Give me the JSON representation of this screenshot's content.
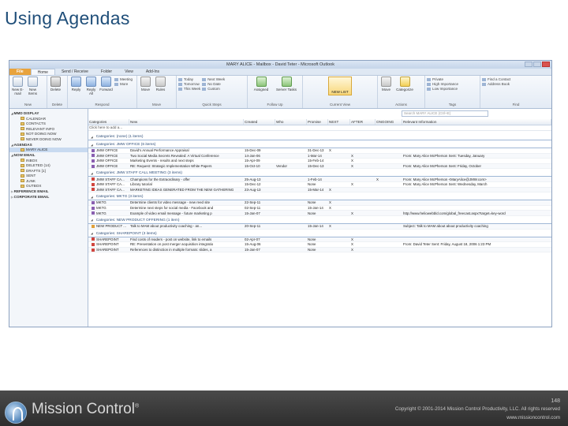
{
  "slide": {
    "title": "Using Agendas"
  },
  "window": {
    "title": "MARY ALICE - Mailbox - David Teter - Microsoft Outlook"
  },
  "ribbon": {
    "tabs": [
      "File",
      "Home",
      "Send / Receive",
      "Folder",
      "View",
      "Add-Ins"
    ],
    "groups": [
      {
        "label": "New",
        "buttons": [
          "New E-mail",
          "New Items"
        ]
      },
      {
        "label": "Delete",
        "buttons": [
          "Delete"
        ]
      },
      {
        "label": "Respond",
        "buttons": [
          "Reply",
          "Reply All",
          "Forward",
          "Meeting",
          "More"
        ]
      },
      {
        "label": "Move",
        "buttons": [
          "Move",
          "Rules"
        ]
      },
      {
        "label": "Quick Steps",
        "buttons": [
          "Today",
          "Tomorrow",
          "This Week",
          "Next Week",
          "No Date",
          "Custom"
        ]
      },
      {
        "label": "Follow Up",
        "buttons": [
          "Assigned",
          "Server Tasks"
        ]
      },
      {
        "label": "Current View",
        "buttons": [
          "NEW LIST"
        ]
      },
      {
        "label": "Actions",
        "buttons": [
          "Move",
          "Categorize"
        ]
      },
      {
        "label": "Tags",
        "buttons": [
          "Private",
          "High Importance",
          "Low Importance"
        ]
      },
      {
        "label": "Find",
        "buttons": [
          "Find a Contact",
          "Address Book"
        ]
      }
    ]
  },
  "nav": {
    "sections": [
      {
        "label": "MMD DISPLAY",
        "open": true,
        "items": [
          "CALENDAR",
          "CONTACTS",
          "RELEVANT INFO",
          "NOT DOING NOW",
          "NEVER DOING NOW"
        ]
      },
      {
        "label": "AGENDAS",
        "open": true,
        "items": [
          "MARY ALICE"
        ]
      },
      {
        "label": "NOW EMAIL",
        "open": true,
        "items": [
          "INBOX",
          "DELETED (14)",
          "DRAFTS [1]",
          "SENT",
          "JUNK",
          "OUTBOX"
        ]
      },
      {
        "label": "REFERENCE EMAIL",
        "open": false,
        "items": []
      },
      {
        "label": "CORPORATE EMAIL",
        "open": false,
        "items": []
      }
    ]
  },
  "search": {
    "placeholder": "Search MARY ALICE (Ctrl+E)"
  },
  "columns": [
    "Categories",
    "New",
    "Created",
    "Who",
    "Promise",
    "NEXT",
    "AFTER",
    "ONGOING",
    "Relevant Information"
  ],
  "add_row": {
    "category": "Click here to add a...",
    "text": ""
  },
  "groups": [
    {
      "header": "Categories: (none) (1 items)",
      "rows": []
    },
    {
      "header": "Categories: JMW OFFICE (6 items)",
      "color": "#8a5fb0",
      "rows": [
        {
          "cat": "JMW OFFICE",
          "new": "David's Annual Performance Appraisal",
          "created": "15-Dec-09",
          "who": "",
          "promise": "31-Dec-13",
          "next": "X",
          "after": "",
          "ongoing": "",
          "rel": ""
        },
        {
          "cat": "JMW OFFICE",
          "new": "Two Social Media Secrets Revealed: A Virtual Conference",
          "created": "14-Jan-06",
          "who": "",
          "promise": "1-Mar-14",
          "next": "",
          "after": "X",
          "ongoing": "",
          "rel": "From: Mary Alice McPherson  Sent: Tuesday, January"
        },
        {
          "cat": "JMW OFFICE",
          "new": "Marketing Events - results and next steps",
          "created": "15-Apr-09",
          "who": "",
          "promise": "15-Feb-14",
          "next": "",
          "after": "X",
          "ongoing": "",
          "rel": ""
        },
        {
          "cat": "JMW OFFICE",
          "new": "RE: Request: Strategic Implementation White Papers",
          "created": "15-Oct-10",
          "who": "Vendor",
          "promise": "15-Dec-13",
          "next": "",
          "after": "X",
          "ongoing": "",
          "rel": "From: Mary Alice McPherson  Sent: Friday, October"
        }
      ]
    },
    {
      "header": "Categories: JMW STAFF CALL MEETING (3 items)",
      "color": "#d0463f",
      "rows": [
        {
          "cat": "JMW STAFF CA...",
          "new": "Champions for the Extraordinary - offer",
          "created": "25-Aug-13",
          "who": "",
          "promise": "1-Feb-14",
          "next": "",
          "after": "",
          "ongoing": "X",
          "rel": "From: Mary Alice McPherson <MaryAlice@JMW.com>"
        },
        {
          "cat": "JMW STAFF CA...",
          "new": "Library tutorial",
          "created": "15-Dec-12",
          "who": "",
          "promise": "None",
          "next": "",
          "after": "X",
          "ongoing": "",
          "rel": "From: Mary Alice McPherson  Sent: Wednesday, March"
        },
        {
          "cat": "JMW STAFF CA...",
          "new": "MARKETING IDEAS GENERATED FROM THE NEW GATHERING",
          "created": "23-Aug-13",
          "who": "",
          "promise": "15-Mar-14",
          "next": "X",
          "after": "",
          "ongoing": "",
          "rel": ""
        }
      ]
    },
    {
      "header": "Categories: MKTG (3 items)",
      "color": "#8a5fb0",
      "rows": [
        {
          "cat": "MKTG",
          "new": "Determine clients for video message - new reed site",
          "created": "22-Sep-11",
          "who": "",
          "promise": "None",
          "next": "X",
          "after": "",
          "ongoing": "",
          "rel": ""
        },
        {
          "cat": "MKTG",
          "new": "Determine next steps for social media - Facebook and",
          "created": "02-Sep-11",
          "who": "",
          "promise": "15-Jan-14",
          "next": "X",
          "after": "",
          "ongoing": "",
          "rel": ""
        },
        {
          "cat": "MKTG",
          "new": "Example of video email message - future marketing p",
          "created": "15-Jan-07",
          "who": "",
          "promise": "None",
          "next": "",
          "after": "X",
          "ongoing": "",
          "rel": "http://www.heliowebbld.com/global_freecast.aspx?target=key-word"
        }
      ]
    },
    {
      "header": "Categories: NEW PRODUCT OFFERING (1 item)",
      "color": "#e0a03a",
      "rows": [
        {
          "cat": "NEW PRODUCT ...",
          "new": "Talk to MAM about productivity coaching - an...",
          "created": "20-Sep-11",
          "who": "",
          "promise": "15-Jan-14",
          "next": "X",
          "after": "",
          "ongoing": "",
          "rel": "Subject:   Talk to MAM about about productivity coaching"
        }
      ]
    },
    {
      "header": "Categories: SHAREPOINT (3 items)",
      "color": "#d0463f",
      "rows": [
        {
          "cat": "SHAREPOINT",
          "new": "Find costs of readers - post on website, link to emails",
          "created": "02-Apr-07",
          "who": "",
          "promise": "None",
          "next": "",
          "after": "X",
          "ongoing": "",
          "rel": ""
        },
        {
          "cat": "SHAREPOINT",
          "new": "RE: Presentation on post merger acquisition integratio",
          "created": "15-Aug-06",
          "who": "",
          "promise": "None",
          "next": "",
          "after": "X",
          "ongoing": "",
          "rel": "From: David Teter  Sent: Friday, August 18, 2006 1:23 PM"
        },
        {
          "cat": "SHAREPOINT",
          "new": "References to distinction in multiple formats: slides, a",
          "created": "15-Jan-07",
          "who": "",
          "promise": "None",
          "next": "",
          "after": "X",
          "ongoing": "",
          "rel": ""
        }
      ]
    }
  ],
  "footer": {
    "brand": "Mission Control",
    "page": "148",
    "copyright": "Copyright © 2001-2014 Mission Control Productivity, LLC. All rights reserved",
    "url": "www.missioncontrol.com"
  }
}
